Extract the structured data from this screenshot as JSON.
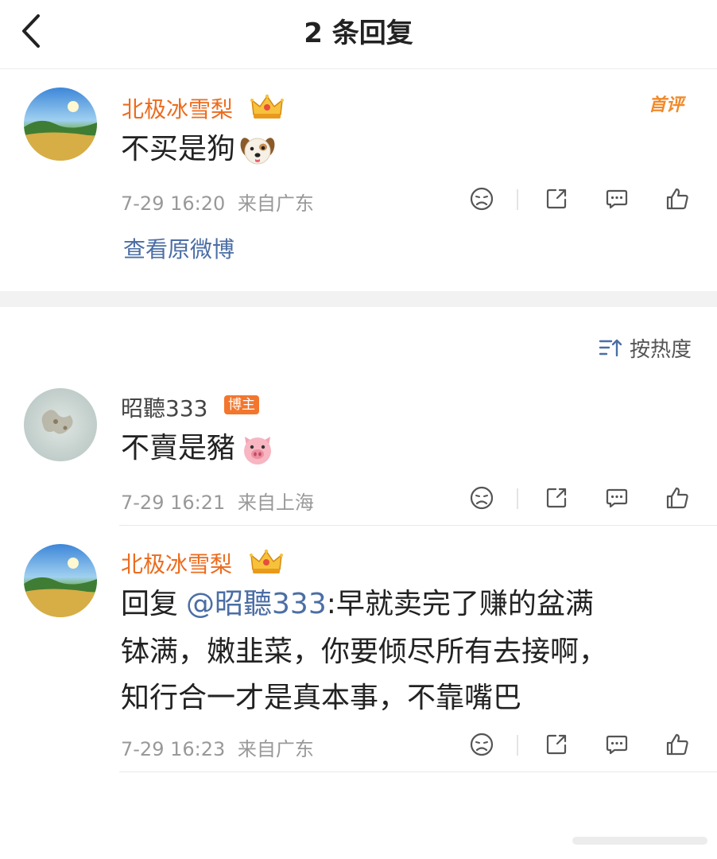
{
  "header": {
    "title": "2 条回复"
  },
  "main_comment": {
    "username": "北极冰雪梨",
    "text": "不买是狗",
    "time": "7-29 16:20",
    "location": "来自广东",
    "badge": "首评",
    "view_original": "查看原微博"
  },
  "sort": {
    "label": "按热度"
  },
  "replies": [
    {
      "username": "昭聽333",
      "tag": "博主",
      "text": "不賣是豬",
      "time": "7-29 16:21",
      "location": "来自上海"
    },
    {
      "username": "北极冰雪梨",
      "prefix": "回复",
      "mention": "@昭聽333",
      "line1": ":早就卖完了赚的盆满",
      "line2": "钵满，嫩韭菜，你要倾尽所有去接啊，",
      "line3": "知行合一才是真本事，不靠嘴巴",
      "time": "7-29 16:23",
      "location": "来自广东"
    }
  ],
  "icons": [
    "back-chevron-icon",
    "crown-icon",
    "dog-emoji-icon",
    "pig-emoji-icon",
    "dislike-icon",
    "share-icon",
    "comment-icon",
    "like-icon",
    "sort-icon"
  ],
  "colors": {
    "username": "#ec6c1f",
    "link": "#4b6ea5",
    "badge": "#f3762d",
    "meta": "#999999"
  }
}
